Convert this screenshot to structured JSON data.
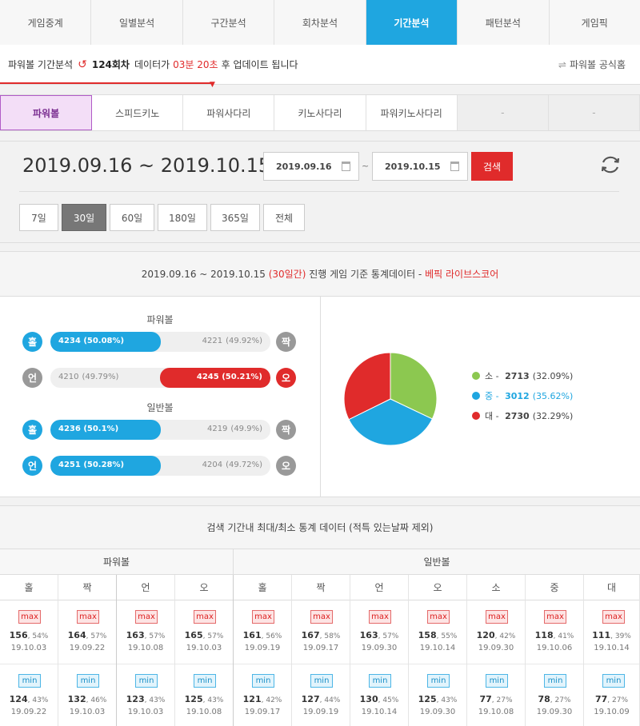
{
  "nav": {
    "tabs": [
      "게임중계",
      "일별분석",
      "구간분석",
      "회차분석",
      "기간분석",
      "패턴분석",
      "게임픽"
    ],
    "active": "기간분석"
  },
  "notice": {
    "prefix": "파워볼 기간분석",
    "round": "124회차",
    "mid": "데이터가",
    "timer": "03분 20초",
    "suffix": "후 업데이트 됩니다",
    "home_link": "파워볼 공식홈"
  },
  "game_tabs": [
    "파워볼",
    "스피드키노",
    "파워사다리",
    "키노사다리",
    "파워키노사다리",
    "-",
    "-"
  ],
  "date": {
    "range_text": "2019.09.16 ~ 2019.10.15",
    "start_input": "2019.09.16",
    "end_input": "2019.10.15",
    "tilde": "~",
    "search_label": "검색",
    "periods": [
      "7일",
      "30일",
      "60일",
      "180일",
      "365일",
      "전체"
    ],
    "active_period": "30일"
  },
  "stats": {
    "header": {
      "range": "2019.09.16 ~ 2019.10.15",
      "days": "(30일간)",
      "text": "진행 게임 기준 통계데이터 -",
      "source": "베픽 라이브스코어"
    },
    "powerball_label": "파워볼",
    "normal_label": "일반볼",
    "rows": [
      {
        "left_icon": "홀",
        "right_icon": "짝",
        "left": "4234 (50.08%)",
        "right": "4221",
        "right_pct": "(49.92%)",
        "fraction": 0.5008,
        "highlight": "left",
        "left_color": "#1fa6e0",
        "right_color": "#999999"
      },
      {
        "left_icon": "언",
        "right_icon": "오",
        "left": "4210",
        "left_pct": "(49.79%)",
        "right": "4245 (50.21%)",
        "fraction": 0.5021,
        "highlight": "right",
        "left_color": "#999999",
        "right_color": "#e02b2b"
      },
      {
        "left_icon": "홀",
        "right_icon": "짝",
        "left": "4236 (50.1%)",
        "right": "4219",
        "right_pct": "(49.9%)",
        "fraction": 0.501,
        "highlight": "left",
        "left_color": "#1fa6e0",
        "right_color": "#999999"
      },
      {
        "left_icon": "언",
        "right_icon": "오",
        "left": "4251 (50.28%)",
        "right": "4204",
        "right_pct": "(49.72%)",
        "fraction": 0.5028,
        "highlight": "left",
        "left_color": "#1fa6e0",
        "right_color": "#999999"
      }
    ],
    "pie": [
      {
        "label": "소",
        "value": 2713,
        "pct": "(32.09%)",
        "color": "#8cc850"
      },
      {
        "label": "중",
        "value": 3012,
        "pct": "(35.62%)",
        "color": "#1fa6e0"
      },
      {
        "label": "대",
        "value": 2730,
        "pct": "(32.29%)",
        "color": "#e02b2b"
      }
    ]
  },
  "minmax": {
    "header": "검색 기간내 최대/최소 통계 데이터 (적특 있는날짜 제외)",
    "group_powerball": "파워볼",
    "group_normal": "일반볼",
    "max_tag": "max",
    "min_tag": "min",
    "columns": [
      {
        "label": "홀",
        "max": "156",
        "max_pct": "54%",
        "max_date": "19.10.03",
        "min": "124",
        "min_pct": "43%",
        "min_date": "19.09.22"
      },
      {
        "label": "짝",
        "max": "164",
        "max_pct": "57%",
        "max_date": "19.09.22",
        "min": "132",
        "min_pct": "46%",
        "min_date": "19.10.03"
      },
      {
        "label": "언",
        "max": "163",
        "max_pct": "57%",
        "max_date": "19.10.08",
        "min": "123",
        "min_pct": "43%",
        "min_date": "19.10.03"
      },
      {
        "label": "오",
        "max": "165",
        "max_pct": "57%",
        "max_date": "19.10.03",
        "min": "125",
        "min_pct": "43%",
        "min_date": "19.10.08"
      },
      {
        "label": "홀",
        "max": "161",
        "max_pct": "56%",
        "max_date": "19.09.19",
        "min": "121",
        "min_pct": "42%",
        "min_date": "19.09.17"
      },
      {
        "label": "짝",
        "max": "167",
        "max_pct": "58%",
        "max_date": "19.09.17",
        "min": "127",
        "min_pct": "44%",
        "min_date": "19.09.19"
      },
      {
        "label": "언",
        "max": "163",
        "max_pct": "57%",
        "max_date": "19.09.30",
        "min": "130",
        "min_pct": "45%",
        "min_date": "19.10.14"
      },
      {
        "label": "오",
        "max": "158",
        "max_pct": "55%",
        "max_date": "19.10.14",
        "min": "125",
        "min_pct": "43%",
        "min_date": "19.09.30"
      },
      {
        "label": "소",
        "max": "120",
        "max_pct": "42%",
        "max_date": "19.09.30",
        "min": "77",
        "min_pct": "27%",
        "min_date": "19.10.08"
      },
      {
        "label": "중",
        "max": "118",
        "max_pct": "41%",
        "max_date": "19.10.06",
        "min": "78",
        "min_pct": "27%",
        "min_date": "19.09.30"
      },
      {
        "label": "대",
        "max": "111",
        "max_pct": "39%",
        "max_date": "19.10.14",
        "min": "77",
        "min_pct": "27%",
        "min_date": "19.10.09"
      }
    ]
  }
}
